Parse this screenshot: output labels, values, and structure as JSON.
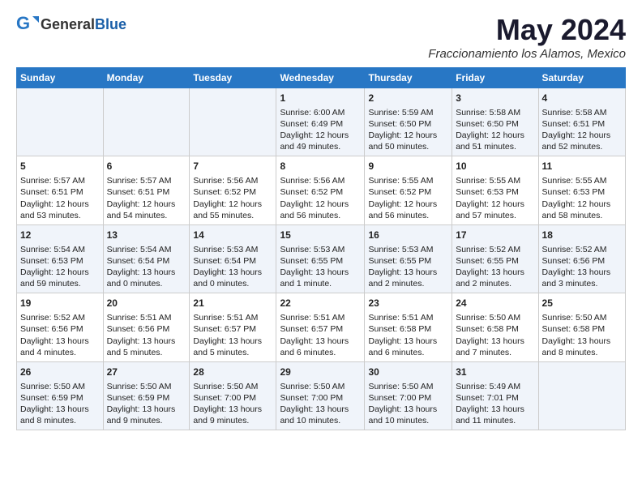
{
  "header": {
    "logo_general": "General",
    "logo_blue": "Blue",
    "month_year": "May 2024",
    "location": "Fraccionamiento los Alamos, Mexico"
  },
  "weekdays": [
    "Sunday",
    "Monday",
    "Tuesday",
    "Wednesday",
    "Thursday",
    "Friday",
    "Saturday"
  ],
  "weeks": [
    [
      {
        "day": "",
        "content": ""
      },
      {
        "day": "",
        "content": ""
      },
      {
        "day": "",
        "content": ""
      },
      {
        "day": "1",
        "content": "Sunrise: 6:00 AM\nSunset: 6:49 PM\nDaylight: 12 hours\nand 49 minutes."
      },
      {
        "day": "2",
        "content": "Sunrise: 5:59 AM\nSunset: 6:50 PM\nDaylight: 12 hours\nand 50 minutes."
      },
      {
        "day": "3",
        "content": "Sunrise: 5:58 AM\nSunset: 6:50 PM\nDaylight: 12 hours\nand 51 minutes."
      },
      {
        "day": "4",
        "content": "Sunrise: 5:58 AM\nSunset: 6:51 PM\nDaylight: 12 hours\nand 52 minutes."
      }
    ],
    [
      {
        "day": "5",
        "content": "Sunrise: 5:57 AM\nSunset: 6:51 PM\nDaylight: 12 hours\nand 53 minutes."
      },
      {
        "day": "6",
        "content": "Sunrise: 5:57 AM\nSunset: 6:51 PM\nDaylight: 12 hours\nand 54 minutes."
      },
      {
        "day": "7",
        "content": "Sunrise: 5:56 AM\nSunset: 6:52 PM\nDaylight: 12 hours\nand 55 minutes."
      },
      {
        "day": "8",
        "content": "Sunrise: 5:56 AM\nSunset: 6:52 PM\nDaylight: 12 hours\nand 56 minutes."
      },
      {
        "day": "9",
        "content": "Sunrise: 5:55 AM\nSunset: 6:52 PM\nDaylight: 12 hours\nand 56 minutes."
      },
      {
        "day": "10",
        "content": "Sunrise: 5:55 AM\nSunset: 6:53 PM\nDaylight: 12 hours\nand 57 minutes."
      },
      {
        "day": "11",
        "content": "Sunrise: 5:55 AM\nSunset: 6:53 PM\nDaylight: 12 hours\nand 58 minutes."
      }
    ],
    [
      {
        "day": "12",
        "content": "Sunrise: 5:54 AM\nSunset: 6:53 PM\nDaylight: 12 hours\nand 59 minutes."
      },
      {
        "day": "13",
        "content": "Sunrise: 5:54 AM\nSunset: 6:54 PM\nDaylight: 13 hours\nand 0 minutes."
      },
      {
        "day": "14",
        "content": "Sunrise: 5:53 AM\nSunset: 6:54 PM\nDaylight: 13 hours\nand 0 minutes."
      },
      {
        "day": "15",
        "content": "Sunrise: 5:53 AM\nSunset: 6:55 PM\nDaylight: 13 hours\nand 1 minute."
      },
      {
        "day": "16",
        "content": "Sunrise: 5:53 AM\nSunset: 6:55 PM\nDaylight: 13 hours\nand 2 minutes."
      },
      {
        "day": "17",
        "content": "Sunrise: 5:52 AM\nSunset: 6:55 PM\nDaylight: 13 hours\nand 2 minutes."
      },
      {
        "day": "18",
        "content": "Sunrise: 5:52 AM\nSunset: 6:56 PM\nDaylight: 13 hours\nand 3 minutes."
      }
    ],
    [
      {
        "day": "19",
        "content": "Sunrise: 5:52 AM\nSunset: 6:56 PM\nDaylight: 13 hours\nand 4 minutes."
      },
      {
        "day": "20",
        "content": "Sunrise: 5:51 AM\nSunset: 6:56 PM\nDaylight: 13 hours\nand 5 minutes."
      },
      {
        "day": "21",
        "content": "Sunrise: 5:51 AM\nSunset: 6:57 PM\nDaylight: 13 hours\nand 5 minutes."
      },
      {
        "day": "22",
        "content": "Sunrise: 5:51 AM\nSunset: 6:57 PM\nDaylight: 13 hours\nand 6 minutes."
      },
      {
        "day": "23",
        "content": "Sunrise: 5:51 AM\nSunset: 6:58 PM\nDaylight: 13 hours\nand 6 minutes."
      },
      {
        "day": "24",
        "content": "Sunrise: 5:50 AM\nSunset: 6:58 PM\nDaylight: 13 hours\nand 7 minutes."
      },
      {
        "day": "25",
        "content": "Sunrise: 5:50 AM\nSunset: 6:58 PM\nDaylight: 13 hours\nand 8 minutes."
      }
    ],
    [
      {
        "day": "26",
        "content": "Sunrise: 5:50 AM\nSunset: 6:59 PM\nDaylight: 13 hours\nand 8 minutes."
      },
      {
        "day": "27",
        "content": "Sunrise: 5:50 AM\nSunset: 6:59 PM\nDaylight: 13 hours\nand 9 minutes."
      },
      {
        "day": "28",
        "content": "Sunrise: 5:50 AM\nSunset: 7:00 PM\nDaylight: 13 hours\nand 9 minutes."
      },
      {
        "day": "29",
        "content": "Sunrise: 5:50 AM\nSunset: 7:00 PM\nDaylight: 13 hours\nand 10 minutes."
      },
      {
        "day": "30",
        "content": "Sunrise: 5:50 AM\nSunset: 7:00 PM\nDaylight: 13 hours\nand 10 minutes."
      },
      {
        "day": "31",
        "content": "Sunrise: 5:49 AM\nSunset: 7:01 PM\nDaylight: 13 hours\nand 11 minutes."
      },
      {
        "day": "",
        "content": ""
      }
    ]
  ]
}
